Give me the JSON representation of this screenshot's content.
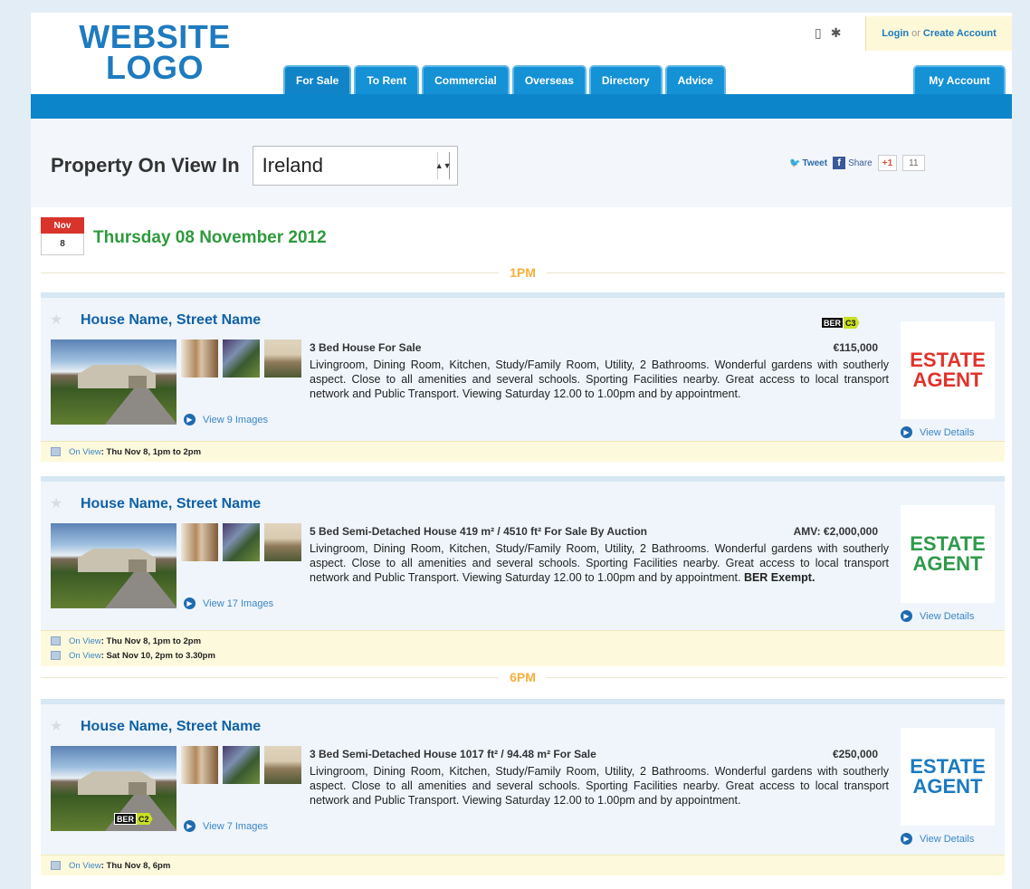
{
  "header": {
    "logo_line1": "WEBSITE",
    "logo_line2": "LOGO",
    "login": "Login",
    "or": "or",
    "create_account": "Create Account",
    "tabs": [
      "For Sale",
      "To Rent",
      "Commercial",
      "Overseas",
      "Directory",
      "Advice"
    ],
    "my_account": "My Account"
  },
  "title_row": {
    "heading": "Property On View In",
    "country": "Ireland"
  },
  "social": {
    "tweet": "Tweet",
    "share": "Share",
    "gplus": "+1",
    "count": "11"
  },
  "date": {
    "month": "Nov",
    "day": "8",
    "heading": "Thursday 08 November 2012"
  },
  "time_labels": [
    "1PM",
    "6PM"
  ],
  "listings": [
    {
      "title": "House Name, Street Name",
      "type": "3 Bed House For Sale",
      "price": "€115,000",
      "description": "Livingroom, Dining Room, Kitchen, Study/Family Room, Utility, 2 Bathrooms. Wonderful gardens with southerly aspect. Close to all amenities and several schools. Sporting Facilities nearby. Great access to local transport network and Public Transport. Viewing Saturday 12.00 to 1.00pm and by appointment.",
      "extra": "",
      "ber_label": "BER",
      "ber_rating": "C3",
      "view_images": "View 9 Images",
      "agent_line1": "ESTATE",
      "agent_line2": "AGENT",
      "agent_color": "#e2322a",
      "view_details": "View Details",
      "on_view_label": "On View",
      "on_view": [
        ": Thu Nov 8, 1pm to 2pm"
      ]
    },
    {
      "title": "House Name, Street Name",
      "type": "5 Bed Semi-Detached House 419 m² / 4510 ft² For Sale By Auction",
      "price": "AMV: €2,000,000",
      "description": "Livingroom, Dining Room, Kitchen, Study/Family Room, Utility, 2 Bathrooms. Wonderful gardens with southerly aspect. Close to all amenities and several schools. Sporting Facilities nearby. Great access to local transport network and Public Transport. Viewing Saturday 12.00 to 1.00pm and by appointment.",
      "extra": "BER Exempt.",
      "ber_label": "",
      "ber_rating": "",
      "view_images": "View 17 Images",
      "agent_line1": "ESTATE",
      "agent_line2": "AGENT",
      "agent_color": "#2e9a4a",
      "view_details": "View Details",
      "on_view_label": "On View",
      "on_view": [
        ": Thu Nov 8, 1pm to 2pm",
        ": Sat Nov 10, 2pm to 3.30pm"
      ]
    },
    {
      "title": "House Name, Street Name",
      "type": "3 Bed Semi-Detached House 1017 ft² / 94.48 m² For Sale",
      "price": "€250,000",
      "description": "Livingroom, Dining Room, Kitchen, Study/Family Room, Utility, 2 Bathrooms. Wonderful gardens with southerly aspect. Close to all amenities and several schools. Sporting Facilities nearby. Great access to local transport network and Public Transport. Viewing Saturday 12.00 to 1.00pm and by appointment.",
      "extra": "",
      "ber_label": "BER",
      "ber_rating": "C2",
      "view_images": "View 7 Images",
      "agent_line1": "ESTATE",
      "agent_line2": "AGENT",
      "agent_color": "#1a7bc2",
      "view_details": "View Details",
      "on_view_label": "On View",
      "on_view": [
        ": Thu Nov 8, 6pm"
      ]
    }
  ],
  "colors": {
    "brand_blue": "#0c85cb",
    "date_green": "#2e9a3c",
    "time_orange": "#f7b03a",
    "ber_green": "#c8e023"
  },
  "icons": [
    "mobile-icon",
    "android-icon",
    "twitter-icon",
    "facebook-icon",
    "star-icon",
    "arrow-circle-icon",
    "calendar-icon"
  ]
}
